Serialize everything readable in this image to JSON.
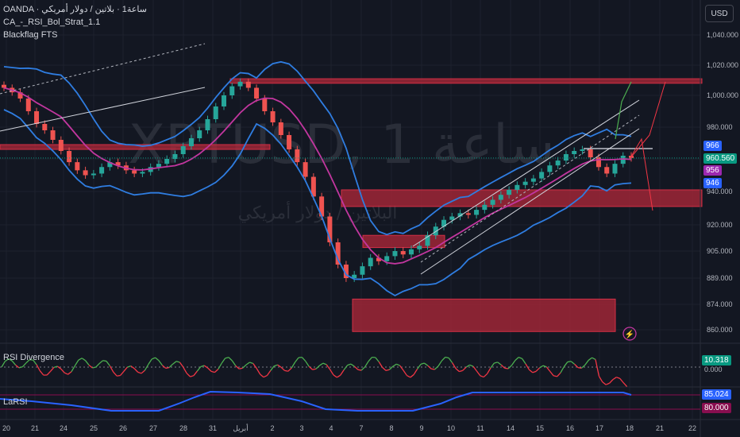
{
  "header": {
    "line1": "OANDA · ساعة1 · بلاتين / دولار أمريكي",
    "line2": "CA_-_RSI_Bol_Strat_1.1",
    "line3": "Blackflag FTS"
  },
  "currency_button": "USD",
  "watermark": {
    "symbol": "XPTUSD, 1 ساعة",
    "name": "البلاتين / دولار أمريكي"
  },
  "colors": {
    "background": "#131722",
    "zone": "#b2283a",
    "up_candle": "#26a69a",
    "down_candle": "#ef5350",
    "bollinger": "#2f7de1",
    "ma": "#c2369f",
    "rsi_up": "#4caf50",
    "rsi_down": "#f23645",
    "larsi": "#2962ff",
    "price_tag": "#089981"
  },
  "panes": {
    "rsi_divergence": {
      "title": "RSI Divergence",
      "value": "10.318",
      "ref_label": "0.000"
    },
    "larsi": {
      "title": "LaRSI",
      "value": "85.024",
      "level": "80.000"
    }
  },
  "price_tags": [
    {
      "label": "966",
      "value": 966,
      "color": "#2962ff"
    },
    {
      "label": "960.560",
      "value": 960.56,
      "color": "#089981"
    },
    {
      "label": "956",
      "value": 956,
      "color": "#9c27b0"
    },
    {
      "label": "946",
      "value": 946,
      "color": "#2962ff"
    }
  ],
  "chart_data": {
    "type": "candlestick",
    "y_axis_ticks": [
      "1,040.000",
      "1,020.000",
      "1,000.000",
      "980.000",
      "960.000",
      "940.000",
      "920.000",
      "905.000",
      "889.000",
      "874.000",
      "860.000"
    ],
    "x_axis_ticks": [
      "20",
      "21",
      "24",
      "25",
      "26",
      "27",
      "28",
      "31",
      "أبريل",
      "2",
      "3",
      "4",
      "7",
      "8",
      "9",
      "10",
      "11",
      "14",
      "15",
      "16",
      "17",
      "18",
      "21",
      "22"
    ],
    "y_range": [
      855,
      1045
    ],
    "grid": true,
    "close_series": [
      1005,
      1002,
      998,
      990,
      982,
      978,
      972,
      965,
      958,
      953,
      950,
      951,
      955,
      958,
      956,
      953,
      951,
      952,
      955,
      957,
      960,
      963,
      968,
      973,
      978,
      985,
      993,
      1000,
      1006,
      1009,
      1005,
      998,
      990,
      983,
      975,
      966,
      958,
      949,
      937,
      925,
      910,
      897,
      889,
      891,
      896,
      901,
      899,
      902,
      905,
      903,
      906,
      908,
      914,
      919,
      923,
      925,
      927,
      926,
      929,
      932,
      935,
      938,
      941,
      944,
      946,
      948,
      952,
      956,
      959,
      963,
      965,
      966,
      961,
      955,
      951,
      957,
      962,
      960.56
    ],
    "zones": [
      {
        "name": "resistance-top",
        "from_date_index": 11,
        "price_top": 1011,
        "price_bottom": 1008
      },
      {
        "name": "resistance-left",
        "from_date_index": 0,
        "price_top": 969,
        "price_bottom": 966
      },
      {
        "name": "mid-zone",
        "from_date_index": 11,
        "price_top": 941,
        "price_bottom": 931
      },
      {
        "name": "support-box",
        "from_date_index": 11,
        "price_top": 877,
        "price_bottom": 859
      },
      {
        "name": "small-zone",
        "from_date_index": 11,
        "price_top": 914,
        "price_bottom": 907
      }
    ]
  }
}
